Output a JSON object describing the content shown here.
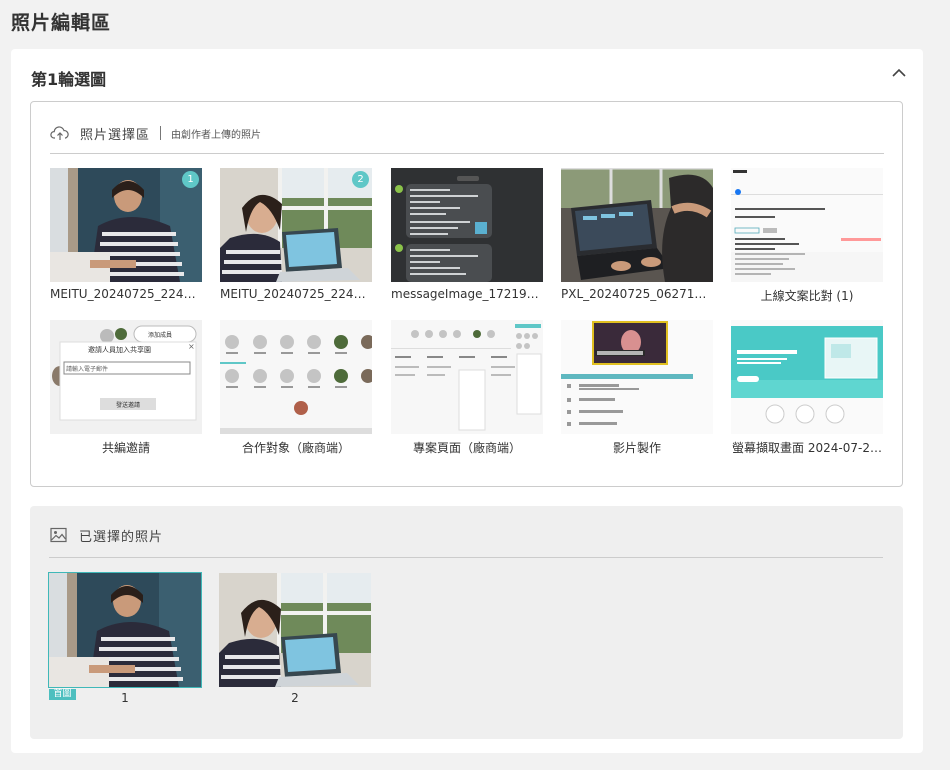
{
  "page": {
    "title": "照片編輯區"
  },
  "round": {
    "title": "第1輪選圖"
  },
  "photo_area": {
    "title": "照片選擇區",
    "subtitle": "由創作者上傳的照片",
    "photos": [
      {
        "caption": "MEITU_20240725_2245…",
        "badge": "1",
        "icon": "woman-laptop-photo"
      },
      {
        "caption": "MEITU_20240725_2245…",
        "badge": "2",
        "icon": "woman-window-photo"
      },
      {
        "caption": "messageImage_17219…",
        "icon": "chat-screenshot"
      },
      {
        "caption": "PXL_20240725_062719…",
        "icon": "laptop-typing-photo"
      },
      {
        "caption": "上線文案比對 (1)",
        "icon": "document-screenshot"
      },
      {
        "caption": "共編邀請",
        "icon": "invite-dialog-screenshot",
        "text": {
          "dialog_title": "邀請人員加入共享園",
          "input": "請輸入電子郵件",
          "button": "發送邀請",
          "top_button": "添加成員"
        }
      },
      {
        "caption": "合作對象（廠商端）",
        "icon": "avatar-grid-screenshot"
      },
      {
        "caption": "專案頁面（廠商端）",
        "icon": "project-page-screenshot"
      },
      {
        "caption": "影片製作",
        "icon": "video-page-screenshot"
      },
      {
        "caption": "螢幕擷取畫面 2024-07-2…",
        "icon": "landing-page-screenshot"
      }
    ]
  },
  "selected_area": {
    "title": "已選擇的照片",
    "cover_label": "首圖",
    "items": [
      {
        "number": "1",
        "icon": "woman-laptop-photo"
      },
      {
        "number": "2",
        "icon": "woman-window-photo"
      }
    ]
  },
  "colors": {
    "accent": "#5fc7c7",
    "border": "#cccccc",
    "panel": "#efefef"
  }
}
